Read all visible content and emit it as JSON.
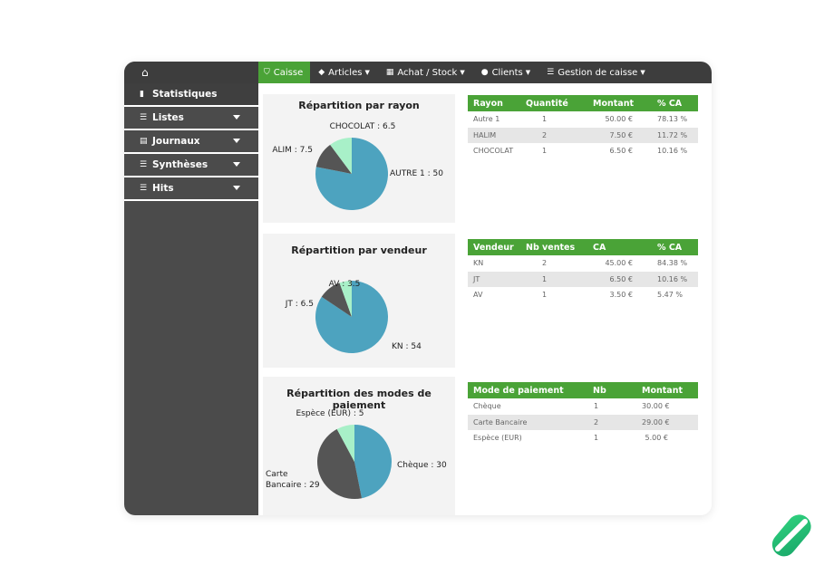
{
  "sidebar": {
    "home_icon": "home-icon",
    "items": [
      {
        "label": "Statistiques",
        "icon": "bar-chart-icon"
      },
      {
        "label": "Listes",
        "icon": "list-icon"
      },
      {
        "label": "Journaux",
        "icon": "journal-icon"
      },
      {
        "label": "Synthèses",
        "icon": "list-icon"
      },
      {
        "label": "Hits",
        "icon": "list-icon"
      }
    ]
  },
  "nav": {
    "tabs": [
      {
        "label": "Caisse",
        "icon": "basket-icon"
      },
      {
        "label": "Articles",
        "icon": "tag-icon"
      },
      {
        "label": "Achat / Stock",
        "icon": "grid-icon"
      },
      {
        "label": "Clients",
        "icon": "user-icon"
      },
      {
        "label": "Gestion de caisse",
        "icon": "list-icon"
      }
    ]
  },
  "colors": {
    "accent": "#4aa337",
    "pie_blue": "#4da3bf",
    "pie_dark": "#555555",
    "pie_mint": "#a8f0c8"
  },
  "charts": [
    {
      "title": "Répartition par rayon",
      "table": {
        "columns": [
          "Rayon",
          "Quantité",
          "Montant",
          "% CA"
        ],
        "rows": [
          [
            "Autre 1",
            "1",
            "50.00 €",
            "78.13 %"
          ],
          [
            "HALIM",
            "2",
            "7.50 €",
            "11.72 %"
          ],
          [
            "CHOCOLAT",
            "1",
            "6.50 €",
            "10.16 %"
          ]
        ]
      }
    },
    {
      "title": "Répartition par vendeur",
      "table": {
        "columns": [
          "Vendeur",
          "Nb ventes",
          "CA",
          "% CA"
        ],
        "rows": [
          [
            "KN",
            "2",
            "45.00 €",
            "84.38 %"
          ],
          [
            "JT",
            "1",
            "6.50 €",
            "10.16 %"
          ],
          [
            "AV",
            "1",
            "3.50 €",
            "5.47 %"
          ]
        ]
      }
    },
    {
      "title": "Répartition des modes de paiement",
      "table": {
        "columns": [
          "Mode de paiement",
          "Nb",
          "Montant"
        ],
        "rows": [
          [
            "Chèque",
            "1",
            "30.00 €"
          ],
          [
            "Carte Bancaire",
            "2",
            "29.00 €"
          ],
          [
            "Espèce (EUR)",
            "1",
            "5.00 €"
          ]
        ]
      }
    }
  ],
  "chart_data": [
    {
      "type": "pie",
      "title": "Répartition par rayon",
      "categories": [
        "AUTRE 1",
        "ALIM",
        "CHOCOLAT"
      ],
      "values": [
        50,
        7.5,
        6.5
      ],
      "labels": [
        "AUTRE 1 : 50",
        "ALIM : 7.5",
        "CHOCOLAT : 6.5"
      ],
      "colors": [
        "#4da3bf",
        "#555555",
        "#a8f0c8"
      ]
    },
    {
      "type": "pie",
      "title": "Répartition par vendeur",
      "categories": [
        "KN",
        "JT",
        "AV"
      ],
      "values": [
        54,
        6.5,
        3.5
      ],
      "labels": [
        "KN : 54",
        "JT : 6.5",
        "AV : 3.5"
      ],
      "colors": [
        "#4da3bf",
        "#555555",
        "#a8f0c8"
      ]
    },
    {
      "type": "pie",
      "title": "Répartition des modes de paiement",
      "categories": [
        "Chèque",
        "Carte Bancaire",
        "Espèce (EUR)"
      ],
      "values": [
        30,
        29,
        5
      ],
      "labels": [
        "Chèque : 30",
        "Carte Bancaire : 29",
        "Espèce (EUR) : 5"
      ],
      "colors": [
        "#4da3bf",
        "#555555",
        "#a8f0c8"
      ]
    }
  ]
}
